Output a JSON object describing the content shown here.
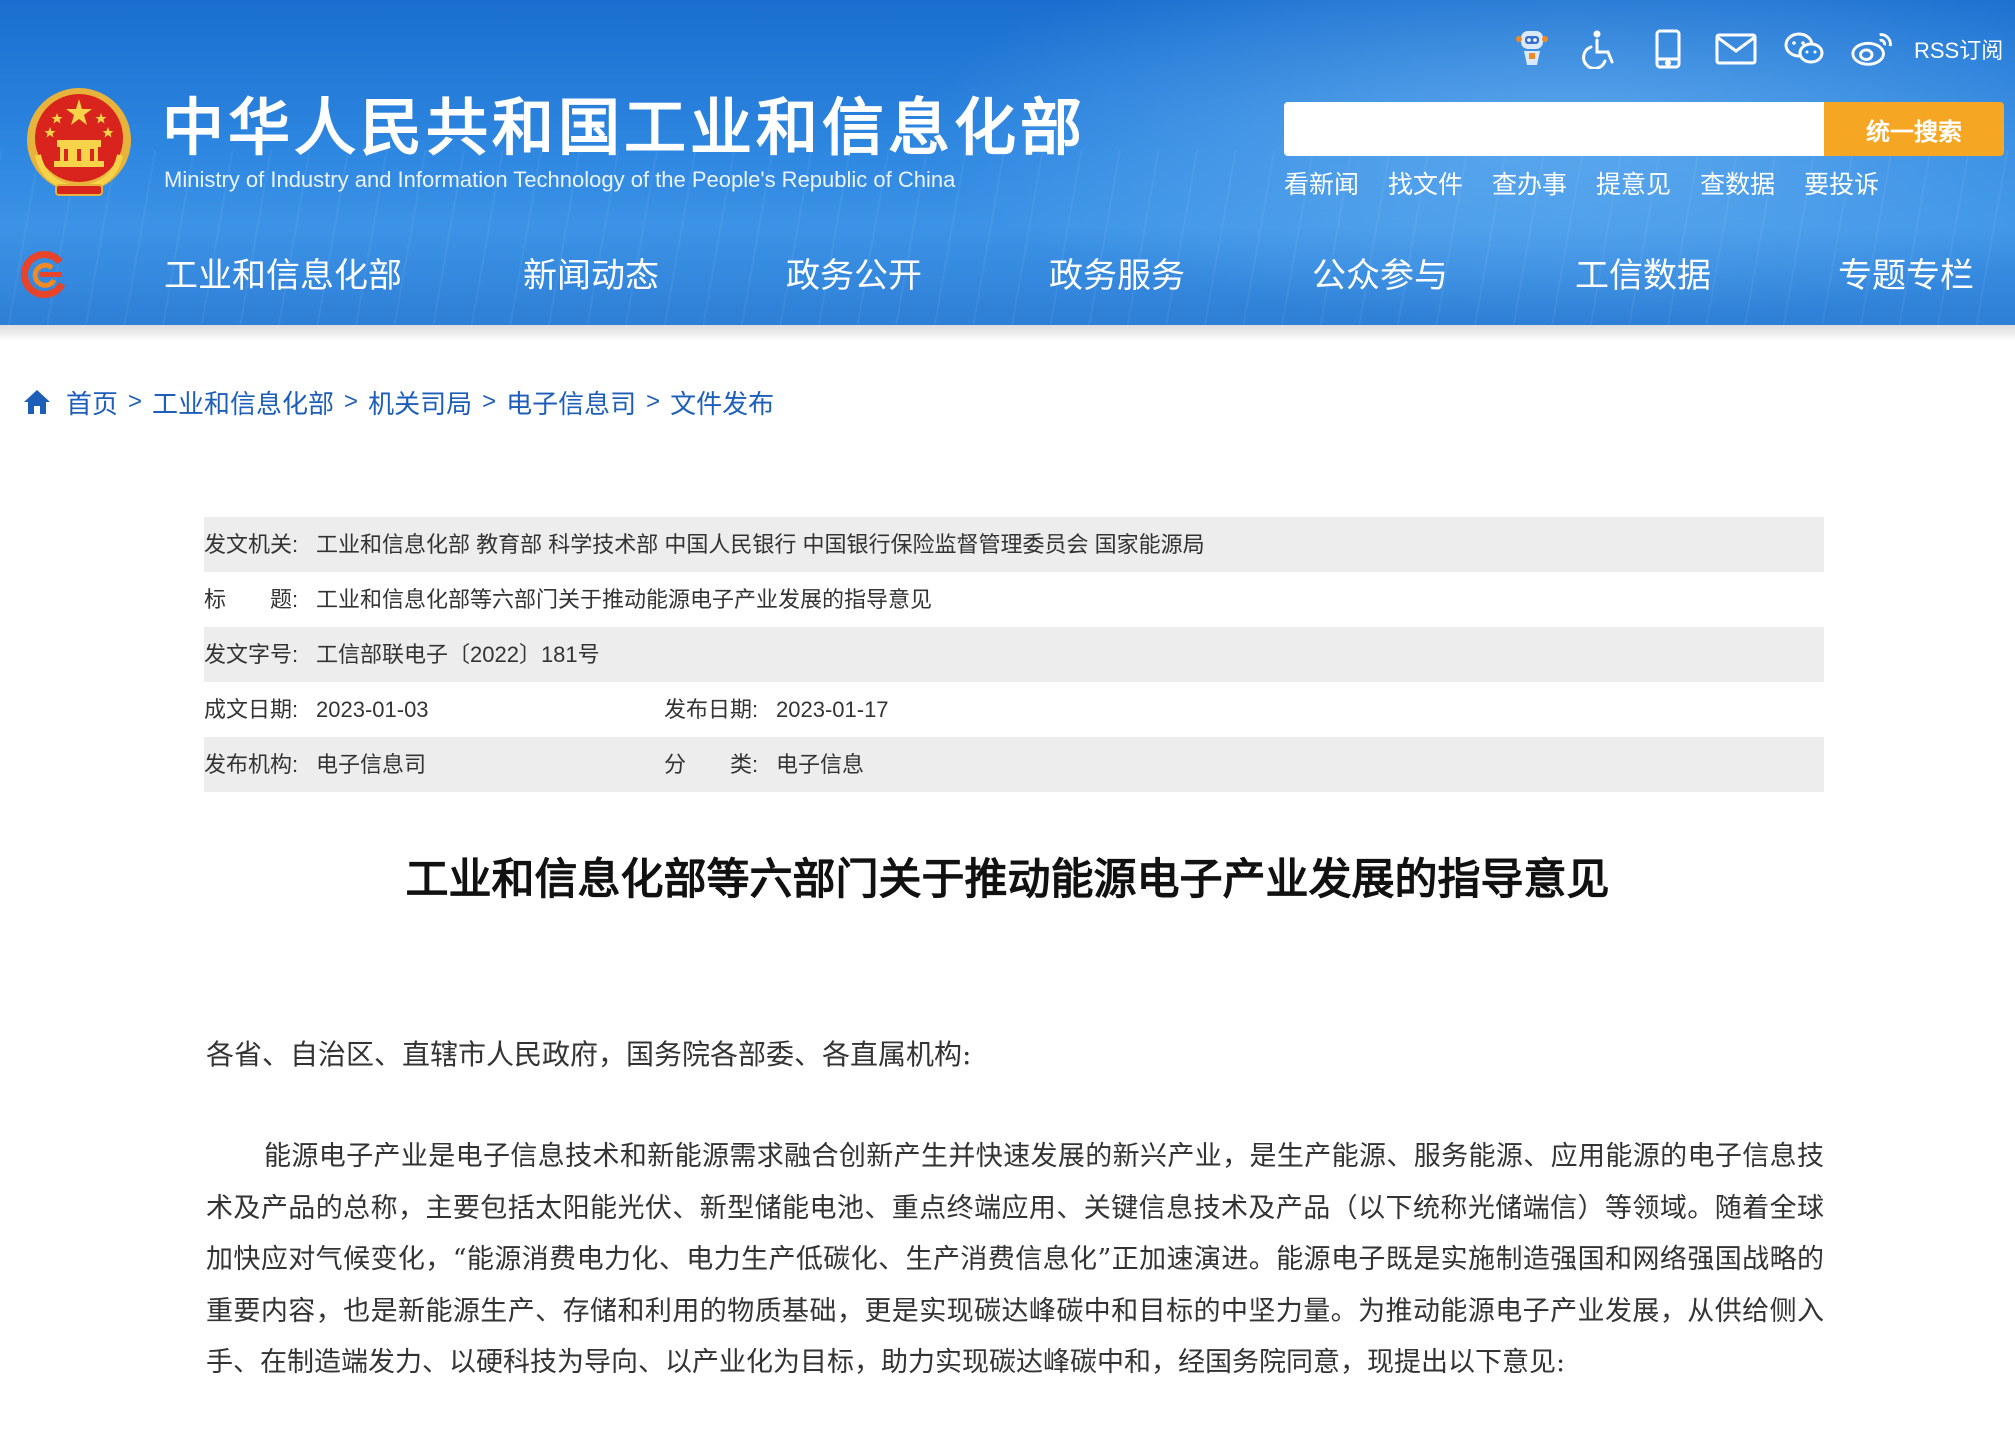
{
  "header": {
    "title": "中华人民共和国工业和信息化部",
    "subtitle": "Ministry of Industry and Information Technology of the People's Republic of China",
    "top_icons": [
      "robot-assistant-icon",
      "accessibility-icon",
      "mobile-icon",
      "mail-icon",
      "wechat-icon",
      "weibo-icon"
    ],
    "rss_label": "RSS订阅",
    "search": {
      "placeholder": "",
      "button_label": "统一搜索"
    },
    "quick_links": [
      "看新闻",
      "找文件",
      "查办事",
      "提意见",
      "查数据",
      "要投诉"
    ]
  },
  "nav": {
    "items": [
      "工业和信息化部",
      "新闻动态",
      "政务公开",
      "政务服务",
      "公众参与",
      "工信数据",
      "专题专栏"
    ]
  },
  "breadcrumb": {
    "items": [
      "首页",
      "工业和信息化部",
      "机关司局",
      "电子信息司",
      "文件发布"
    ],
    "separator": ">"
  },
  "meta": {
    "issuer_label": "发文机关:",
    "issuer_value": "工业和信息化部 教育部 科学技术部 中国人民银行 中国银行保险监督管理委员会 国家能源局",
    "title_label": "标　　题:",
    "title_value": "工业和信息化部等六部门关于推动能源电子产业发展的指导意见",
    "doc_no_label": "发文字号:",
    "doc_no_value": "工信部联电子〔2022〕181号",
    "created_label": "成文日期:",
    "created_value": "2023-01-03",
    "published_label": "发布日期:",
    "published_value": "2023-01-17",
    "org_label": "发布机构:",
    "org_value": "电子信息司",
    "category_label": "分　　类:",
    "category_value": "电子信息"
  },
  "article": {
    "title": "工业和信息化部等六部门关于推动能源电子产业发展的指导意见",
    "salutation": "各省、自治区、直辖市人民政府，国务院各部委、各直属机构:",
    "paragraph": "能源电子产业是电子信息技术和新能源需求融合创新产生并快速发展的新兴产业，是生产能源、服务能源、应用能源的电子信息技术及产品的总称，主要包括太阳能光伏、新型储能电池、重点终端应用、关键信息技术及产品（以下统称光储端信）等领域。随着全球加快应对气候变化，“能源消费电力化、电力生产低碳化、生产消费信息化”正加速演进。能源电子既是实施制造强国和网络强国战略的重要内容，也是新能源生产、存储和利用的物质基础，更是实现碳达峰碳中和目标的中坚力量。为推动能源电子产业发展，从供给侧入手、在制造端发力、以硬科技为导向、以产业化为目标，助力实现碳达峰碳中和，经国务院同意，现提出以下意见:"
  },
  "colors": {
    "header_blue": "#2d86e0",
    "search_button": "#f5a623",
    "link_blue": "#1d5fb8",
    "meta_shade": "#ededed"
  }
}
